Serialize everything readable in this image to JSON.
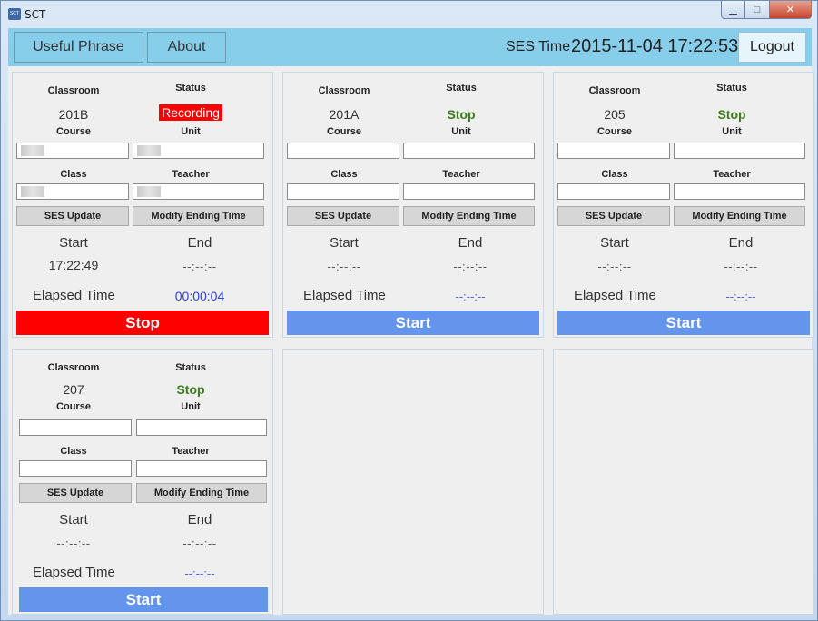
{
  "window": {
    "title": "SCT",
    "icon_text": "SCT"
  },
  "topbar": {
    "useful_phrase": "Useful Phrase",
    "about": "About",
    "ses_label": "SES Time",
    "ses_time": "2015-11-04 17:22:53",
    "logout": "Logout"
  },
  "labels": {
    "classroom": "Classroom",
    "status": "Status",
    "course": "Course",
    "unit": "Unit",
    "class": "Class",
    "teacher": "Teacher",
    "ses_update": "SES Update",
    "modify_ending": "Modify Ending Time",
    "start": "Start",
    "end": "End",
    "elapsed": "Elapsed Time"
  },
  "panels": [
    {
      "classroom": "201B",
      "status": "Recording",
      "start_time": "17:22:49",
      "end_time": "--:--:--",
      "elapsed": "00:00:04",
      "action": "Stop"
    },
    {
      "classroom": "201A",
      "status": "Stop",
      "start_time": "--:--:--",
      "end_time": "--:--:--",
      "elapsed": "--:--:--",
      "action": "Start"
    },
    {
      "classroom": "205",
      "status": "Stop",
      "start_time": "--:--:--",
      "end_time": "--:--:--",
      "elapsed": "--:--:--",
      "action": "Start"
    },
    {
      "classroom": "207",
      "status": "Stop",
      "start_time": "--:--:--",
      "end_time": "--:--:--",
      "elapsed": "--:--:--",
      "action": "Start"
    }
  ],
  "colors": {
    "topbar": "#87ceeb",
    "stop": "#ff0000",
    "start": "#6495ed",
    "status_stop": "#3c7a1d"
  }
}
